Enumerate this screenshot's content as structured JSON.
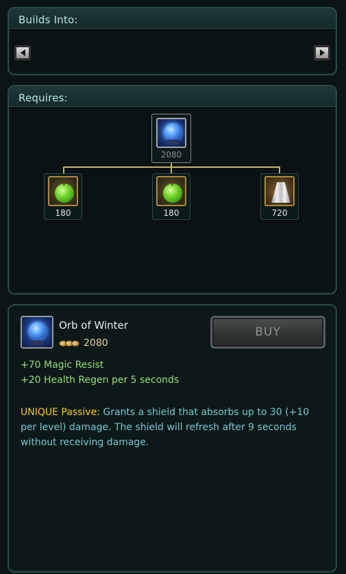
{
  "builds_into": {
    "header": "Builds Into:"
  },
  "requires": {
    "header": "Requires:",
    "root": {
      "icon": "orb-of-winter-icon",
      "price": "2080"
    },
    "components": [
      {
        "icon": "green-apple-icon",
        "price": "180"
      },
      {
        "icon": "green-apple-icon",
        "price": "180"
      },
      {
        "icon": "white-cloak-icon",
        "price": "720"
      }
    ]
  },
  "details": {
    "icon": "orb-of-winter-icon",
    "name": "Orb of Winter",
    "cost": "2080",
    "buy_label": "BUY",
    "stats": [
      "+70 Magic Resist",
      "+20 Health Regen per 5 seconds"
    ],
    "passive_label": "UNIQUE Passive:",
    "passive_text": " Grants a shield that absorbs up to 30 (+10 per level) damage. The shield will refresh after 9 seconds without receiving damage."
  },
  "colors": {
    "panel_border": "#2c4a4a",
    "header_text": "#b8e6e2",
    "stat_text": "#93e07a",
    "unique_label": "#ffc81a",
    "passive_text": "#74c8cf",
    "tree_line": "#c8b463"
  }
}
